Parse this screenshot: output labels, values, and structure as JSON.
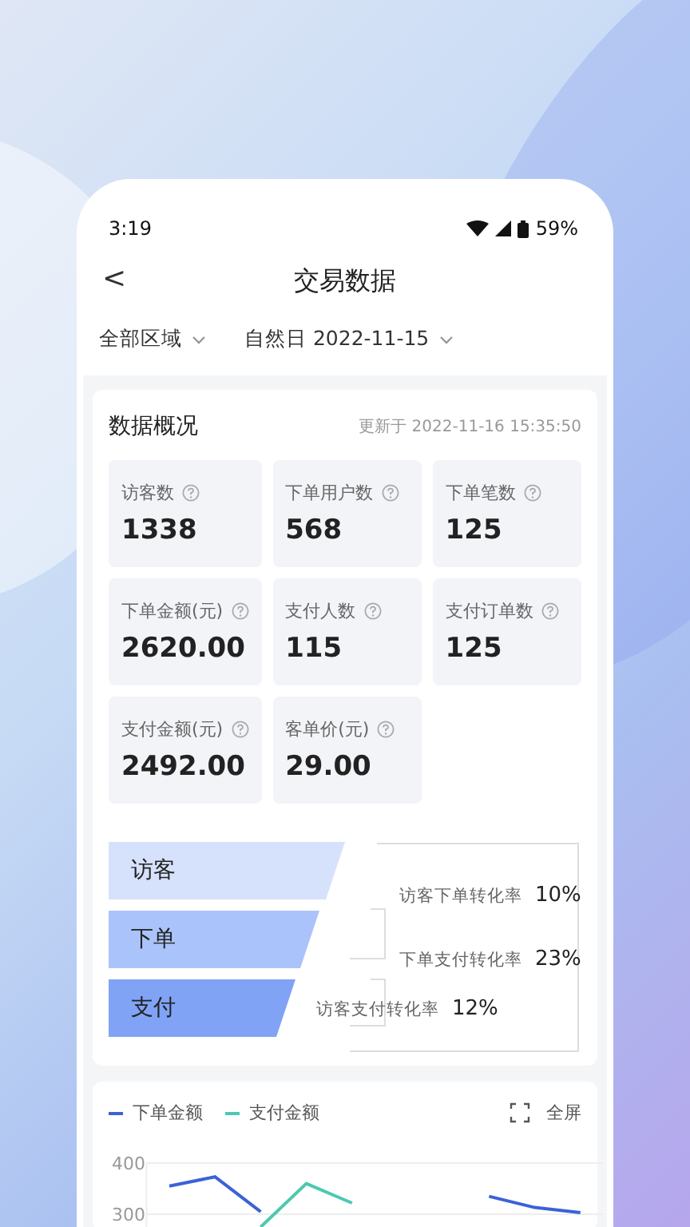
{
  "status_bar": {
    "time": "3:19",
    "battery": "59%"
  },
  "nav": {
    "back": "<",
    "title": "交易数据"
  },
  "filters": [
    {
      "label": "全部区域"
    },
    {
      "label": "自然日 2022-11-15"
    }
  ],
  "overview": {
    "title": "数据概况",
    "updated": "更新于 2022-11-16 15:35:50",
    "metrics": [
      {
        "label": "访客数",
        "value": "1338"
      },
      {
        "label": "下单用户数",
        "value": "568"
      },
      {
        "label": "下单笔数",
        "value": "125"
      },
      {
        "label": "下单金额(元)",
        "value": "2620.00"
      },
      {
        "label": "支付人数",
        "value": "115"
      },
      {
        "label": "支付订单数",
        "value": "125"
      },
      {
        "label": "支付金额(元)",
        "value": "2492.00"
      },
      {
        "label": "客单价(元)",
        "value": "29.00"
      }
    ],
    "funnel": {
      "stages": [
        {
          "label": "访客",
          "color": "#d6e2fc"
        },
        {
          "label": "下单",
          "color": "#aac3fa"
        },
        {
          "label": "支付",
          "color": "#80a3f5"
        }
      ],
      "rates": [
        {
          "label": "访客下单转化率",
          "value": "10%"
        },
        {
          "label": "下单支付转化率",
          "value": "23%"
        },
        {
          "label": "访客支付转化率",
          "value": "12%"
        }
      ]
    }
  },
  "trend": {
    "fullscreen": "全屏",
    "chart_data": {
      "type": "line",
      "ylim": [
        270,
        400
      ],
      "yticks": [
        300,
        400
      ],
      "series": [
        {
          "name": "下单金额",
          "color": "#3b62d6",
          "values": [
            355,
            373,
            305,
            null,
            null,
            null,
            null,
            335,
            313,
            303
          ]
        },
        {
          "name": "支付金额",
          "color": "#4cc9b0",
          "values": [
            null,
            null,
            275,
            360,
            322,
            null,
            null,
            null,
            null,
            null
          ]
        }
      ]
    }
  }
}
